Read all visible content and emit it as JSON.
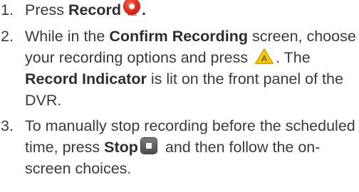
{
  "steps": [
    {
      "number": "1.",
      "prefix": "Press ",
      "bold": "Record",
      "suffix": "."
    },
    {
      "number": "2.",
      "part1": "While in the ",
      "bold1": "Confirm Recording",
      "part2": " screen, choose your recording options and press ",
      "part3": ". The ",
      "bold2": "Record Indicator",
      "part4": " is lit on the front panel of the DVR."
    },
    {
      "number": "3.",
      "part1": "To manually stop recording before the scheduled time, press ",
      "bold1": "Stop",
      "part2": " and then follow the on-screen choices."
    }
  ],
  "icons": {
    "record": {
      "name": "record-icon",
      "label": "REC",
      "color": "#e8321d"
    },
    "a_button": {
      "name": "a-button-icon",
      "letter": "A",
      "color": "#f5c800"
    },
    "stop": {
      "name": "stop-icon",
      "color": "#5a5a5a"
    }
  }
}
